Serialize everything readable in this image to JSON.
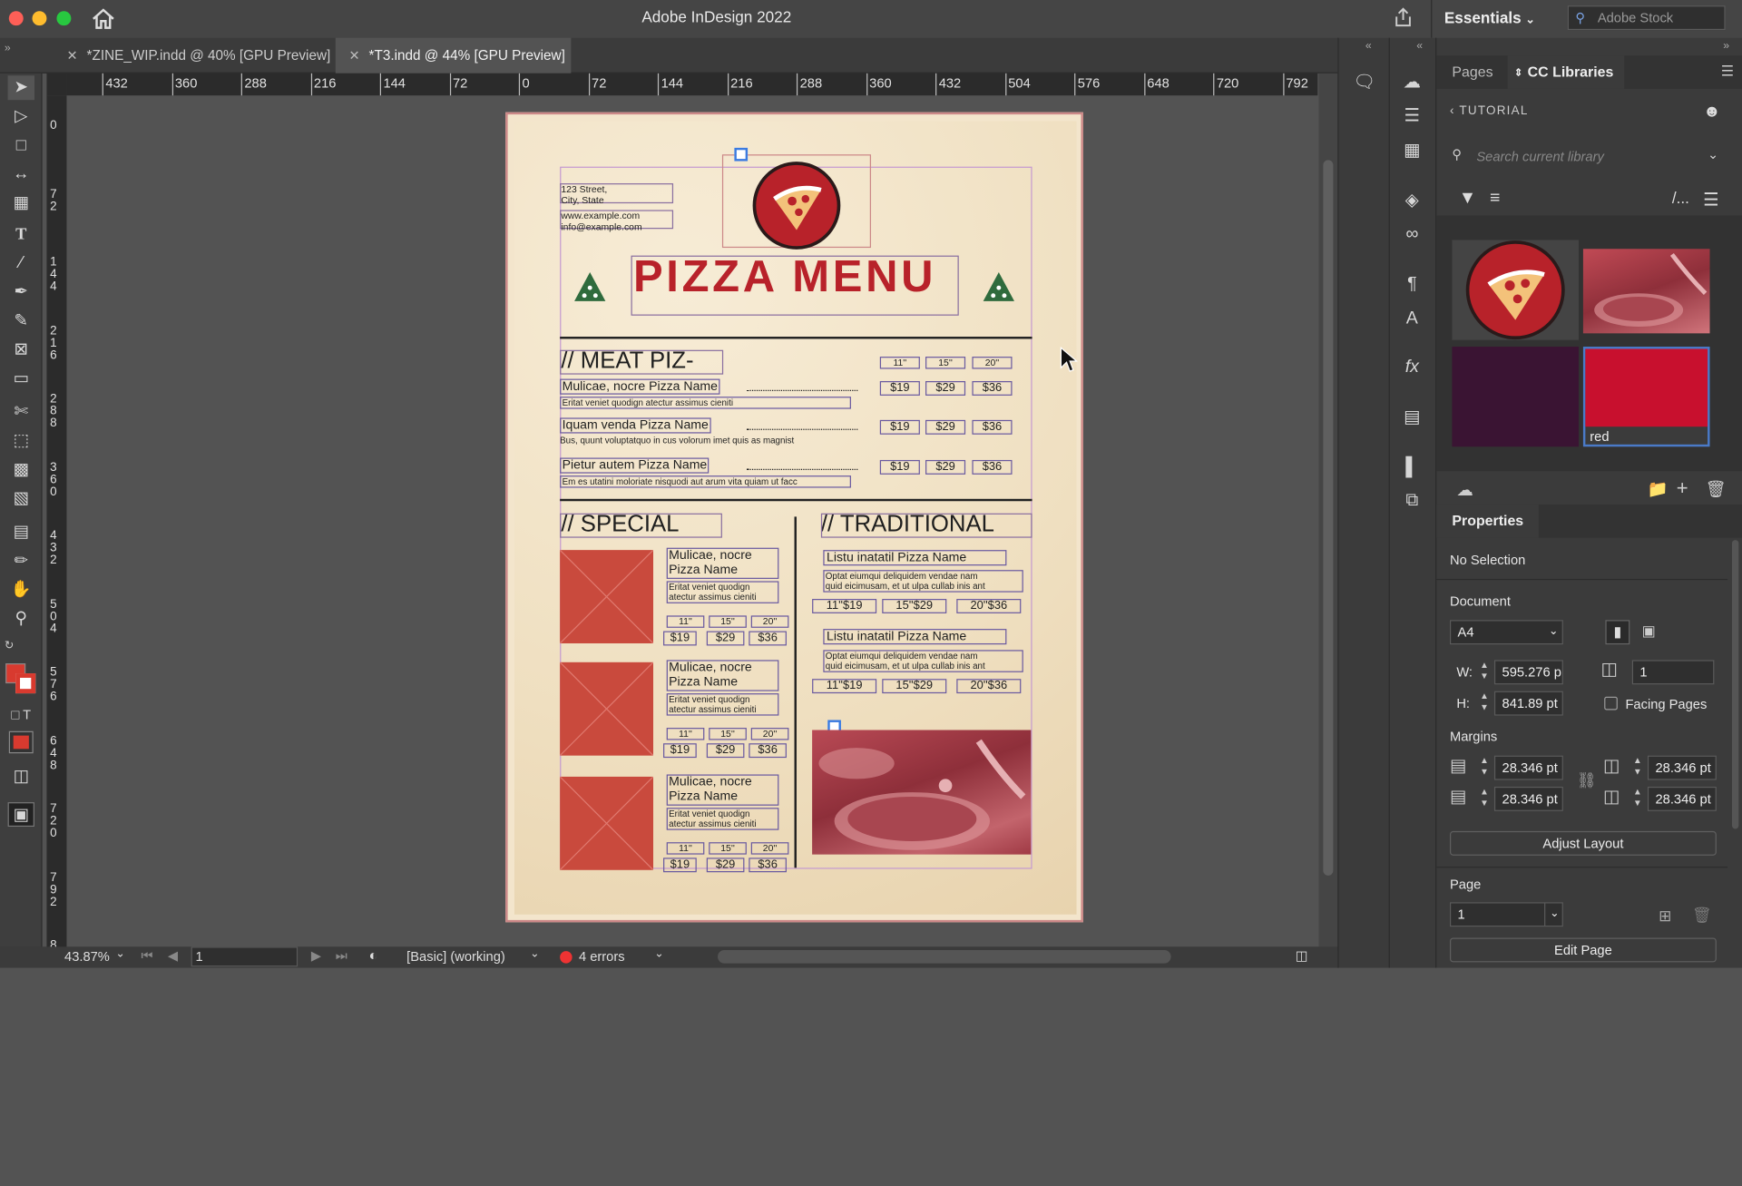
{
  "app": {
    "title": "Adobe InDesign 2022",
    "workspace": "Essentials",
    "stock_search_placeholder": "Adobe Stock"
  },
  "tabs": [
    {
      "label": "*ZINE_WIP.indd @ 40% [GPU Preview]",
      "active": false
    },
    {
      "label": "*T3.indd @ 44% [GPU Preview]",
      "active": true
    }
  ],
  "ruler": {
    "h": [
      "432",
      "360",
      "288",
      "216",
      "144",
      "72",
      "0",
      "72",
      "144",
      "216",
      "288",
      "360",
      "432",
      "504",
      "576",
      "648",
      "720",
      "792"
    ],
    "v": [
      "0",
      "72",
      "144",
      "216",
      "288",
      "360",
      "432",
      "504",
      "576",
      "648",
      "720",
      "792",
      "8"
    ]
  },
  "status": {
    "zoom": "43.87%",
    "page": "1",
    "preflight_profile": "[Basic] (working)",
    "errors": "4 errors"
  },
  "panel": {
    "tabs": [
      "Pages",
      "CC Libraries"
    ],
    "library_back": "TUTORIAL",
    "search_placeholder": "Search current library",
    "swatch_label": "red",
    "properties_tab": "Properties",
    "selection": "No Selection",
    "document_label": "Document",
    "preset": "A4",
    "w_label": "W:",
    "w_value": "595.276 p",
    "h_label": "H:",
    "h_value": "841.89 pt",
    "pages_count": "1",
    "facing_pages": "Facing Pages",
    "margins_label": "Margins",
    "margin_top": "28.346 pt",
    "margin_bottom": "28.346 pt",
    "margin_left": "28.346 pt",
    "margin_right": "28.346 pt",
    "adjust_layout": "Adjust Layout",
    "page_label": "Page",
    "page_value": "1",
    "edit_page": "Edit Page"
  },
  "colors": {
    "accent_red": "#c8102e",
    "swatch_purple": "#3a1433",
    "brand_red": "#b8222a"
  },
  "menu": {
    "address": [
      "123 Street,",
      "City, State"
    ],
    "contact": [
      "www.example.com",
      "info@example.com"
    ],
    "title": "PIZZA MENU",
    "meat_heading": "// MEAT PIZ-",
    "sizes": [
      "11''",
      "15''",
      "20''"
    ],
    "meat_items": [
      {
        "name": "Mulicae, nocre Pizza Name",
        "desc": "Eritat veniet quodign atectur assimus cieniti",
        "prices": [
          "$19",
          "$29",
          "$36"
        ]
      },
      {
        "name": "Iquam venda Pizza Name",
        "desc": "Bus, quunt voluptatquo in cus volorum imet quis as magnist",
        "prices": [
          "$19",
          "$29",
          "$36"
        ]
      },
      {
        "name": "Pietur autem Pizza Name",
        "desc": "Em es utatini moloriate nisquodi aut arum vita quiam ut facc",
        "prices": [
          "$19",
          "$29",
          "$36"
        ]
      }
    ],
    "special_heading": "// SPECIAL",
    "special_items": [
      {
        "name1": "Mulicae, nocre",
        "name2": "Pizza Name",
        "desc1": "Eritat veniet quodign",
        "desc2": "atectur assimus cieniti",
        "prices": [
          "$19",
          "$29",
          "$36"
        ]
      },
      {
        "name1": "Mulicae, nocre",
        "name2": "Pizza Name",
        "desc1": "Eritat veniet quodign",
        "desc2": "atectur assimus cieniti",
        "prices": [
          "$19",
          "$29",
          "$36"
        ]
      },
      {
        "name1": "Mulicae, nocre",
        "name2": "Pizza Name",
        "desc1": "Eritat veniet quodign",
        "desc2": "atectur assimus cieniti",
        "prices": [
          "$19",
          "$29",
          "$36"
        ]
      }
    ],
    "traditional_heading": "// TRADITIONAL",
    "traditional_items": [
      {
        "name": "Listu inatatil Pizza Name",
        "desc1": "Optat eiumqui deliquidem vendae nam",
        "desc2": "quid eicimusam, et ut ulpa cullab inis ant",
        "prices": [
          "11''$19",
          "15''$29",
          "20''$36"
        ]
      },
      {
        "name": "Listu inatatil Pizza Name",
        "desc1": "Optat eiumqui deliquidem vendae nam",
        "desc2": "quid eicimusam, et ut ulpa cullab inis ant",
        "prices": [
          "11''$19",
          "15''$29",
          "20''$36"
        ]
      }
    ]
  }
}
